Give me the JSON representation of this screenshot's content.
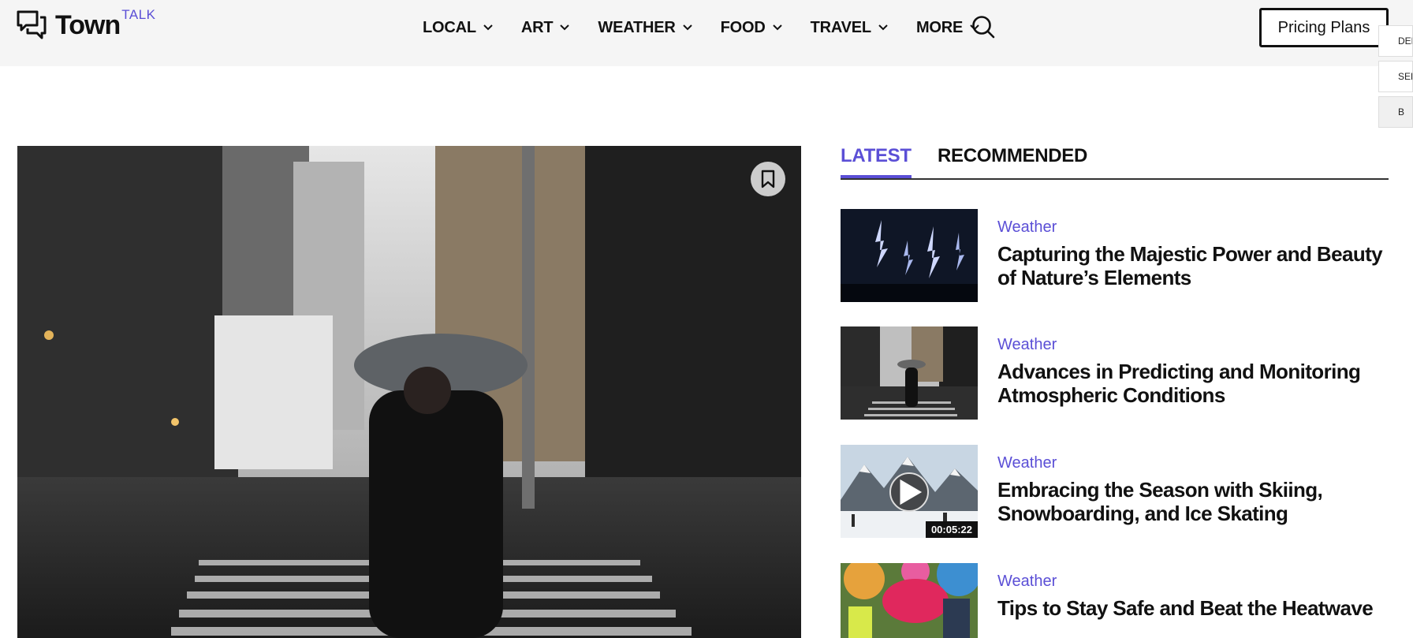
{
  "brand": {
    "name_main": "Town",
    "name_accent": "TALK",
    "accent_color": "#5b4fd6"
  },
  "nav": {
    "items": [
      {
        "label": "LOCAL"
      },
      {
        "label": "ART"
      },
      {
        "label": "WEATHER"
      },
      {
        "label": "FOOD"
      },
      {
        "label": "TRAVEL"
      },
      {
        "label": "MORE"
      }
    ],
    "search_icon": "search-icon"
  },
  "header": {
    "pricing_label": "Pricing Plans"
  },
  "side_tabs": [
    {
      "label": "DEM"
    },
    {
      "label": "SERV"
    },
    {
      "label": "B"
    }
  ],
  "tabs": {
    "latest": "LATEST",
    "recommended": "RECOMMENDED"
  },
  "articles": [
    {
      "category": "Weather",
      "title": "Capturing the Majestic Power and Beauty of Nature’s Elements"
    },
    {
      "category": "Weather",
      "title": "Advances in Predicting and Monitoring Atmospheric Conditions"
    },
    {
      "category": "Weather",
      "title": "Embracing the Season with Skiing, Snowboarding, and Ice Skating",
      "duration": "00:05:22"
    },
    {
      "category": "Weather",
      "title": "Tips to Stay Safe and Beat the Heatwave"
    }
  ]
}
